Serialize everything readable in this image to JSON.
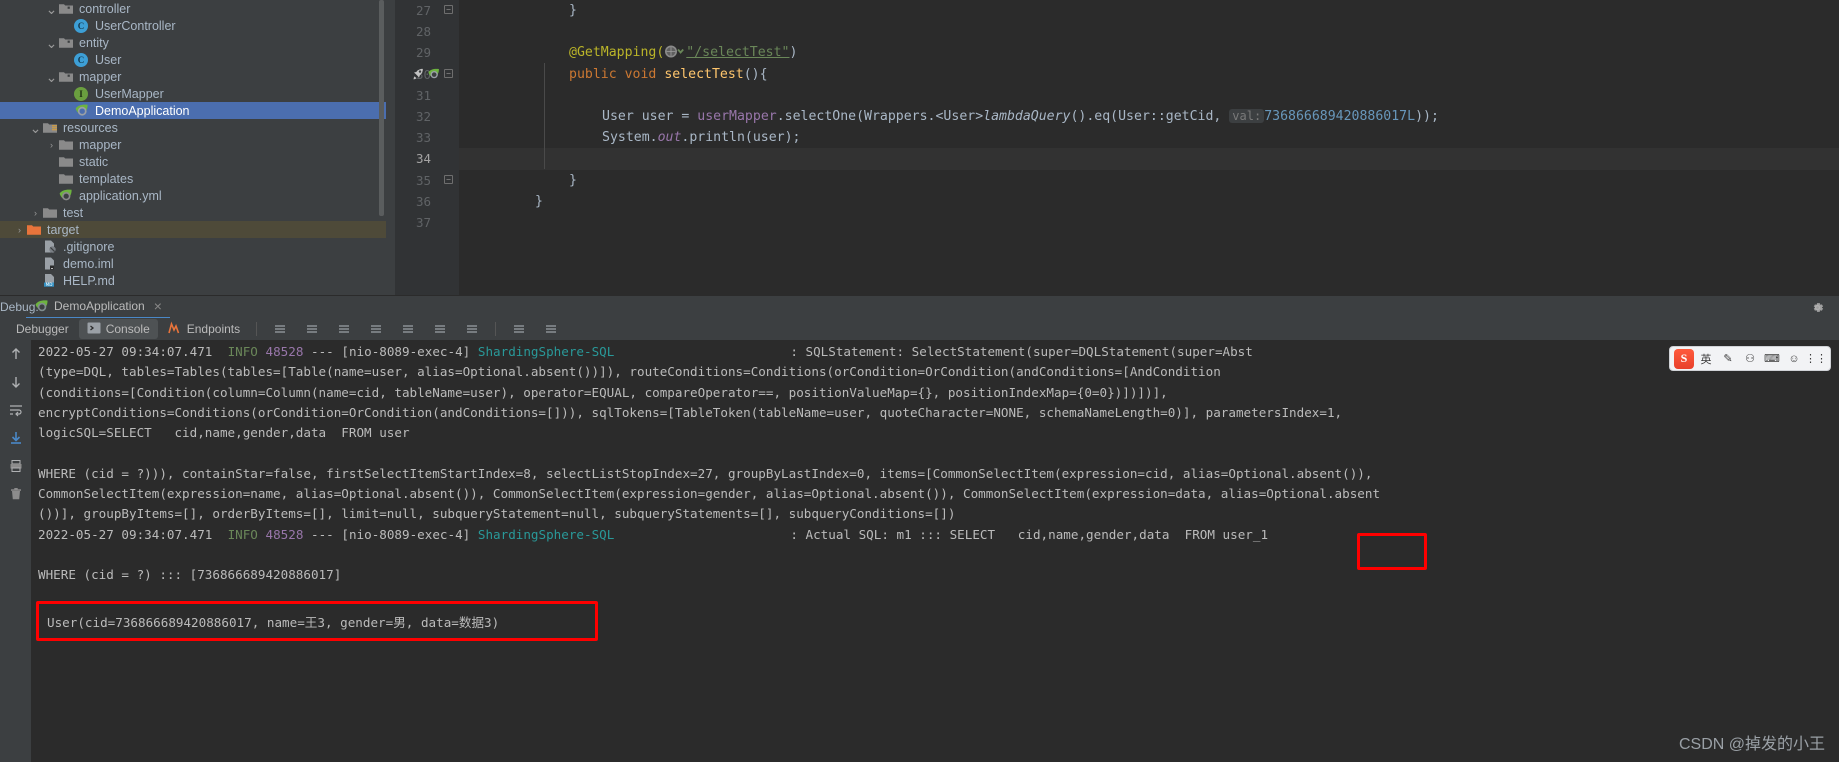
{
  "project_tree": {
    "name": "project-tool-window",
    "items": [
      {
        "label": "controller",
        "indent": 3,
        "arrow": "v",
        "icon": "package-icon",
        "state": "normal"
      },
      {
        "label": "UserController",
        "indent": 4,
        "arrow": "",
        "icon": "java-class-icon",
        "state": "normal"
      },
      {
        "label": "entity",
        "indent": 3,
        "arrow": "v",
        "icon": "package-icon",
        "state": "normal"
      },
      {
        "label": "User",
        "indent": 4,
        "arrow": "",
        "icon": "java-class-icon",
        "state": "normal"
      },
      {
        "label": "mapper",
        "indent": 3,
        "arrow": "v",
        "icon": "package-icon",
        "state": "normal"
      },
      {
        "label": "UserMapper",
        "indent": 4,
        "arrow": "",
        "icon": "java-interface-icon",
        "state": "normal"
      },
      {
        "label": "DemoApplication",
        "indent": 4,
        "arrow": "",
        "icon": "spring-boot-icon",
        "state": "selected"
      },
      {
        "label": "resources",
        "indent": 2,
        "arrow": "v",
        "icon": "resources-root-icon",
        "state": "normal"
      },
      {
        "label": "mapper",
        "indent": 3,
        "arrow": ">",
        "icon": "folder-icon",
        "state": "normal"
      },
      {
        "label": "static",
        "indent": 3,
        "arrow": "",
        "icon": "folder-icon",
        "state": "normal"
      },
      {
        "label": "templates",
        "indent": 3,
        "arrow": "",
        "icon": "folder-icon",
        "state": "normal"
      },
      {
        "label": "application.yml",
        "indent": 3,
        "arrow": "",
        "icon": "spring-yaml-icon",
        "state": "normal"
      },
      {
        "label": "test",
        "indent": 2,
        "arrow": ">",
        "icon": "folder-icon",
        "state": "normal"
      },
      {
        "label": "target",
        "indent": 1,
        "arrow": ">",
        "icon": "target-folder-icon",
        "state": "target"
      },
      {
        "label": ".gitignore",
        "indent": 2,
        "arrow": "",
        "icon": "gitignore-icon",
        "state": "normal"
      },
      {
        "label": "demo.iml",
        "indent": 2,
        "arrow": "",
        "icon": "iml-file-icon",
        "state": "normal"
      },
      {
        "label": "HELP.md",
        "indent": 2,
        "arrow": "",
        "icon": "markdown-icon",
        "state": "normal"
      }
    ]
  },
  "editor": {
    "name": "code-editor",
    "gutter": [
      {
        "num": "27",
        "fold": true,
        "run": false,
        "current": false
      },
      {
        "num": "28",
        "fold": false,
        "run": false,
        "current": false
      },
      {
        "num": "29",
        "fold": false,
        "run": false,
        "current": false
      },
      {
        "num": "30",
        "fold": true,
        "run": true,
        "current": false
      },
      {
        "num": "31",
        "fold": false,
        "run": false,
        "current": false
      },
      {
        "num": "32",
        "fold": false,
        "run": false,
        "current": false
      },
      {
        "num": "33",
        "fold": false,
        "run": false,
        "current": false
      },
      {
        "num": "34",
        "fold": false,
        "run": false,
        "current": true
      },
      {
        "num": "35",
        "fold": true,
        "run": false,
        "current": false
      },
      {
        "num": "36",
        "fold": false,
        "run": false,
        "current": false
      },
      {
        "num": "37",
        "fold": false,
        "run": false,
        "current": false
      }
    ],
    "lines": {
      "l27_brace": "}",
      "l29_annotation": "@GetMapping(",
      "l29_string": "\"/selectTest\"",
      "l29_close": ")",
      "l30_kw1": "public",
      "l30_kw2": "void",
      "l30_method": "selectTest",
      "l30_rest": "(){",
      "l32_type": "User",
      "l32_var": " user = ",
      "l32_field": "userMapper",
      "l32_call": ".selectOne(Wrappers.<User>",
      "l32_lambda": "lambdaQuery",
      "l32_eq": "().eq(User::getCid,",
      "l32_hint": "val:",
      "l32_num": "736866689420886017L",
      "l32_tail": "));",
      "l33_sys": "System.",
      "l33_out": "out",
      "l33_print": ".println(user);",
      "l35_brace": "}",
      "l36_brace": "}"
    }
  },
  "debug_window": {
    "name": "debug-tool-window",
    "title": "Debug:",
    "config_tab": "DemoApplication",
    "close_label": "×",
    "tabs": [
      {
        "label": "Debugger",
        "icon": "debugger-icon",
        "active": false
      },
      {
        "label": "Console",
        "icon": "console-icon",
        "active": true
      },
      {
        "label": "Endpoints",
        "icon": "endpoints-icon",
        "active": false
      }
    ],
    "side_buttons": [
      "scroll-up-icon",
      "scroll-down-icon",
      "soft-wrap-icon",
      "scroll-to-end-icon",
      "print-icon",
      "trash-icon"
    ],
    "settings_icon": "gear-icon"
  },
  "console": {
    "name": "console-output",
    "lines": [
      {
        "type": "log",
        "ts": "2022-05-27 09:34:07.471",
        "level": "INFO",
        "pid": "48528",
        "dash": "---",
        "thread": "[nio-8089-exec-4]",
        "logger": "ShardingSphere-SQL",
        "msg": ": SQLStatement: SelectStatement(super=DQLStatement(super=Abst"
      },
      {
        "type": "plain",
        "text": "(type=DQL, tables=Tables(tables=[Table(name=user, alias=Optional.absent())]), routeConditions=Conditions(orCondition=OrCondition(andConditions=[AndCondition"
      },
      {
        "type": "plain",
        "text": "(conditions=[Condition(column=Column(name=cid, tableName=user), operator=EQUAL, compareOperator==, positionValueMap={}, positionIndexMap={0=0})])])],"
      },
      {
        "type": "plain",
        "text": "encryptConditions=Conditions(orCondition=OrCondition(andConditions=[])), sqlTokens=[TableToken(tableName=user, quoteCharacter=NONE, schemaNameLength=0)], parametersIndex=1,"
      },
      {
        "type": "plain",
        "text": "logicSQL=SELECT   cid,name,gender,data  FROM user"
      },
      {
        "type": "plain",
        "text": ""
      },
      {
        "type": "plain",
        "text": "WHERE (cid = ?))), containStar=false, firstSelectItemStartIndex=8, selectListStopIndex=27, groupByLastIndex=0, items=[CommonSelectItem(expression=cid, alias=Optional.absent()),"
      },
      {
        "type": "plain",
        "text": "CommonSelectItem(expression=name, alias=Optional.absent()), CommonSelectItem(expression=gender, alias=Optional.absent()), CommonSelectItem(expression=data, alias=Optional.absent"
      },
      {
        "type": "plain",
        "text": "())], groupByItems=[], orderByItems=[], limit=null, subqueryStatement=null, subqueryStatements=[], subqueryConditions=[])"
      },
      {
        "type": "log",
        "ts": "2022-05-27 09:34:07.471",
        "level": "INFO",
        "pid": "48528",
        "dash": "---",
        "thread": "[nio-8089-exec-4]",
        "logger": "ShardingSphere-SQL",
        "msg": ": Actual SQL: m1 ::: SELECT   cid,name,gender,data  FROM ",
        "boxed_tail": "user_1"
      },
      {
        "type": "plain",
        "text": ""
      },
      {
        "type": "plain",
        "text": "WHERE (cid = ?) ::: [736866689420886017]"
      }
    ],
    "result_line": "User(cid=736866689420886017, name=王3, gender=男, data=数据3)"
  },
  "annotations": {
    "box_color": "#ff0000",
    "boxes": [
      {
        "name": "actual-table-highlight",
        "target": "user_1"
      },
      {
        "name": "query-result-highlight",
        "target": "User(cid=736866689420886017, name=王3, gender=男, data=数据3)"
      }
    ]
  },
  "ime_toolbar": {
    "name": "ime-floating-toolbar",
    "logo": "S",
    "items": [
      {
        "label": "英",
        "name": "ime-language-toggle"
      },
      {
        "label": "✎",
        "name": "ime-handwriting-icon"
      },
      {
        "label": "⚇",
        "name": "ime-voice-icon"
      },
      {
        "label": "⌨",
        "name": "ime-keyboard-icon"
      },
      {
        "label": "☺",
        "name": "ime-emoji-icon"
      },
      {
        "label": "⋮⋮",
        "name": "ime-menu-icon"
      }
    ]
  },
  "watermark": {
    "name": "csdn-watermark",
    "text": "CSDN @掉发的小王"
  }
}
